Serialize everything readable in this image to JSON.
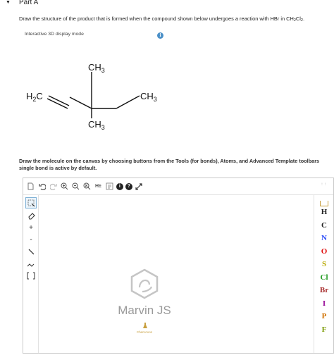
{
  "part": {
    "caret": "▼",
    "title": "Part A"
  },
  "question": {
    "text_before": "Draw the structure of the product that is formed when the compound shown below undergoes a reaction with HBr in CH",
    "sub1": "2",
    "mid": "Cl",
    "sub2": "2",
    "text_after": "."
  },
  "display_mode": {
    "label": "Interactive 3D display mode",
    "info_icon": "i"
  },
  "molecule": {
    "top_methyl": "CH",
    "top_methyl_sub": "3",
    "left_group": "H",
    "left_group_sub": "2",
    "left_group_end": "C",
    "right_methyl": "CH",
    "right_methyl_sub": "3",
    "bottom_methyl": "CH",
    "bottom_methyl_sub": "3"
  },
  "instructions": {
    "line1": "Draw the molecule on the canvas by choosing buttons from the Tools (for bonds), Atoms, and Advanced Template toolbars",
    "line2": "single bond is active by default."
  },
  "editor": {
    "top_toolbar": {
      "hs_label": "H±",
      "info_label": "i",
      "help_label": "?",
      "right_label": "↑ ↑"
    },
    "atoms": [
      "H",
      "C",
      "N",
      "O",
      "S",
      "Cl",
      "Br",
      "I",
      "P",
      "F"
    ],
    "atom_colors": {
      "H": "#222222",
      "C": "#222222",
      "N": "#3050f8",
      "O": "#e01010",
      "S": "#b8a800",
      "Cl": "#1f9a1f",
      "Br": "#a62929",
      "I": "#940094",
      "P": "#d07000",
      "F": "#7a9a00"
    },
    "left_tools": [
      "+",
      "-"
    ],
    "brand": "Marvin JS",
    "chemaxon": "ChemAxon"
  }
}
